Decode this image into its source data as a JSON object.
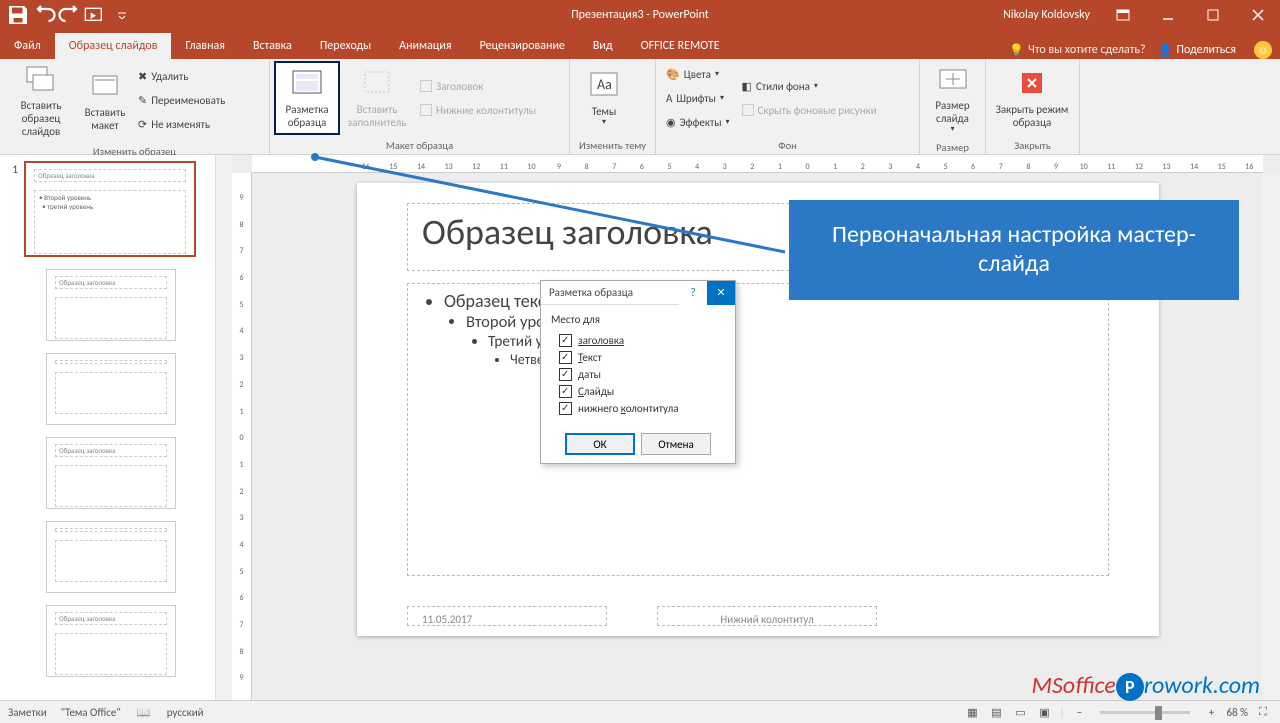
{
  "title": "Презентация3 - PowerPoint",
  "username": "Nikolay Koldovsky",
  "tabs": {
    "file": "Файл",
    "active": "Образец слайдов",
    "home": "Главная",
    "insert": "Вставка",
    "transitions": "Переходы",
    "animations": "Анимация",
    "review": "Рецензирование",
    "view": "Вид",
    "remote": "OFFICE REMOTE",
    "tellme": "Что вы хотите сделать?",
    "share": "Поделиться"
  },
  "ribbon": {
    "g1": {
      "label": "Изменить образец",
      "insert_master": "Вставить образец слайдов",
      "insert_layout": "Вставить макет",
      "delete": "Удалить",
      "rename": "Переименовать",
      "preserve": "Не изменять"
    },
    "g2": {
      "label": "Макет образца",
      "layout": "Разметка образца",
      "placeholder": "Вставить заполнитель",
      "title_cb": "Заголовок",
      "footers_cb": "Нижние колонтитулы"
    },
    "g3": {
      "label": "Изменить тему",
      "themes": "Темы"
    },
    "g4": {
      "label": "Фон",
      "colors": "Цвета",
      "fonts": "Шрифты",
      "effects": "Эффекты",
      "styles": "Стили фона",
      "hide": "Скрыть фоновые рисунки"
    },
    "g5": {
      "label": "Размер",
      "size": "Размер слайда"
    },
    "g6": {
      "label": "Закрыть",
      "close": "Закрыть режим образца"
    }
  },
  "thumbs": {
    "num1": "1",
    "master_title": "Образец заголовка",
    "layout_title": "Образец заголовка"
  },
  "ruler_h": [
    "16",
    "15",
    "14",
    "13",
    "12",
    "11",
    "10",
    "9",
    "8",
    "7",
    "6",
    "5",
    "4",
    "3",
    "2",
    "1",
    "0",
    "1",
    "2",
    "3",
    "4",
    "5",
    "6",
    "7",
    "8",
    "9",
    "10",
    "11",
    "12",
    "13",
    "14",
    "15",
    "16"
  ],
  "ruler_v": [
    "9",
    "8",
    "7",
    "6",
    "5",
    "4",
    "3",
    "2",
    "1",
    "0",
    "1",
    "2",
    "3",
    "4",
    "5",
    "6",
    "7",
    "8",
    "9"
  ],
  "slide": {
    "title": "Образец заголовка",
    "b1": "Образец текста",
    "b2": "Второй уровень",
    "b3": "Третий уровень",
    "b4": "Четвертый",
    "date": "11.05.2017",
    "footer": "Нижний колонтитул"
  },
  "dialog": {
    "title": "Разметка образца",
    "group": "Место для",
    "c1": "заголовка",
    "c2": "Текст",
    "c3": "даты",
    "c4": "Слайды",
    "c5": "нижнего колонтитула",
    "ok": "ОК",
    "cancel": "Отмена"
  },
  "callout": "Первоначальная настройка мастер-слайда",
  "statusbar": {
    "notes": "Заметки",
    "theme": "\"Тема Office\"",
    "lang": "русский",
    "zoom": "68 %"
  },
  "watermark": {
    "a": "MSoffice",
    "b": "rowork.com"
  }
}
